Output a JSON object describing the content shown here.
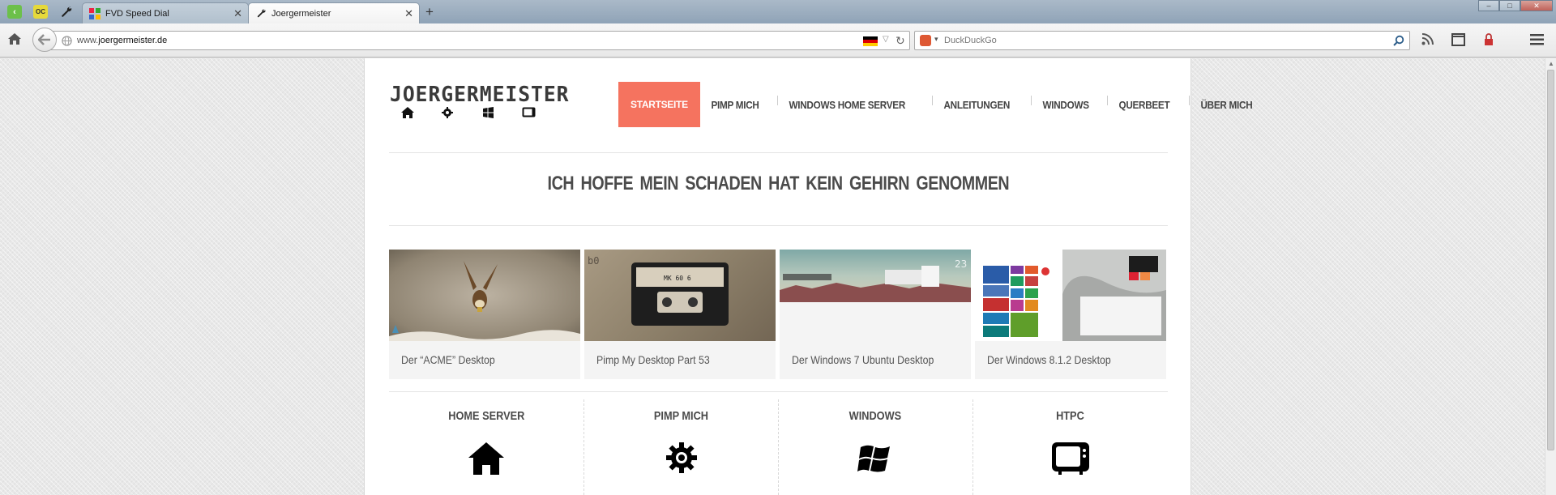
{
  "browser": {
    "tabs": [
      {
        "label": "FVD Speed Dial",
        "active": false
      },
      {
        "label": "Joergermeister",
        "active": true
      }
    ],
    "url_prefix": "www.",
    "url_domain": "joergermeister.de",
    "search_placeholder": "DuckDuckGo",
    "icons": [
      "home-icon",
      "back-icon",
      "reload-icon",
      "search-icon",
      "rss-icon",
      "fullscreen-icon",
      "lock-icon",
      "menu-icon"
    ]
  },
  "site": {
    "logo": "JOERGERMEISTER",
    "nav": [
      {
        "label": "STARTSEITE",
        "active": true
      },
      {
        "label": "PIMP MICH"
      },
      {
        "label": "WINDOWS HOME SERVER"
      },
      {
        "label": "ANLEITUNGEN"
      },
      {
        "label": "WINDOWS"
      },
      {
        "label": "QUERBEET"
      },
      {
        "label": "ÜBER MICH"
      }
    ],
    "tagline": "ICH HOFFE MEIN SCHADEN HAT KEIN GEHIRN GENOMMEN",
    "posts": [
      {
        "title": "Der “ACME” Desktop"
      },
      {
        "title": "Pimp My Desktop Part 53"
      },
      {
        "title": "Der Windows 7 Ubuntu Desktop"
      },
      {
        "title": "Der Windows 8.1.2 Desktop"
      }
    ],
    "categories": [
      {
        "title": "HOME SERVER",
        "icon": "home-icon"
      },
      {
        "title": "PIMP MICH",
        "icon": "gear-icon"
      },
      {
        "title": "WINDOWS",
        "icon": "windows-icon"
      },
      {
        "title": "HTPC",
        "icon": "tv-icon"
      }
    ]
  },
  "colors": {
    "accent": "#f5735f"
  }
}
